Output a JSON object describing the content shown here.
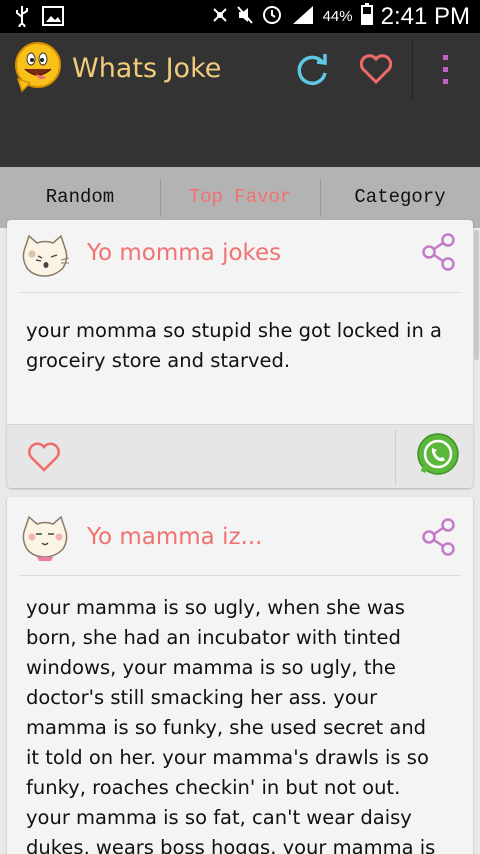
{
  "status_bar": {
    "battery_percent": "44%",
    "time": "2:41 PM",
    "icons": [
      "usb-icon",
      "image-icon",
      "nfc-icon",
      "mute-icon",
      "alarm-icon",
      "signal-icon",
      "battery-icon"
    ]
  },
  "app_bar": {
    "title": "Whats Joke",
    "logo_icon": "smiley-face-icon",
    "actions": [
      "refresh-icon",
      "favorite-heart-icon",
      "overflow-menu-icon"
    ],
    "colors": {
      "title": "#f0cb7a",
      "refresh": "#5fc7e6",
      "heart": "#ef6b6b",
      "overflow": "#c163c1",
      "background": "#333333"
    }
  },
  "tabs": {
    "items": [
      "Random",
      "Top Favor",
      "Category"
    ],
    "selected": "Top Favor",
    "colors": {
      "selected_text": "#f57070",
      "indicator": "#a4d43d"
    }
  },
  "jokes": [
    {
      "title": "Yo momma jokes",
      "avatar_icon": "cat-face-icon",
      "text": "your momma so stupid she got locked in a groceiry store and starved."
    },
    {
      "title": "Yo mamma iz...",
      "avatar_icon": "cat-face-icon",
      "text": "your mamma is so ugly, when she was born, she had an incubator with tinted windows, your mamma is so ugly, the doctor's still smacking her ass. your mamma is so funky, she used secret and it told on her. your mamma's drawls is so funky, roaches checkin' in but not out. your mamma is so fat, can't wear daisy dukes, wears boss hoggs. your mamma is so fat, police use her"
    }
  ],
  "card_footer": {
    "icons": [
      "heart-outline-icon",
      "whatsapp-icon"
    ]
  }
}
